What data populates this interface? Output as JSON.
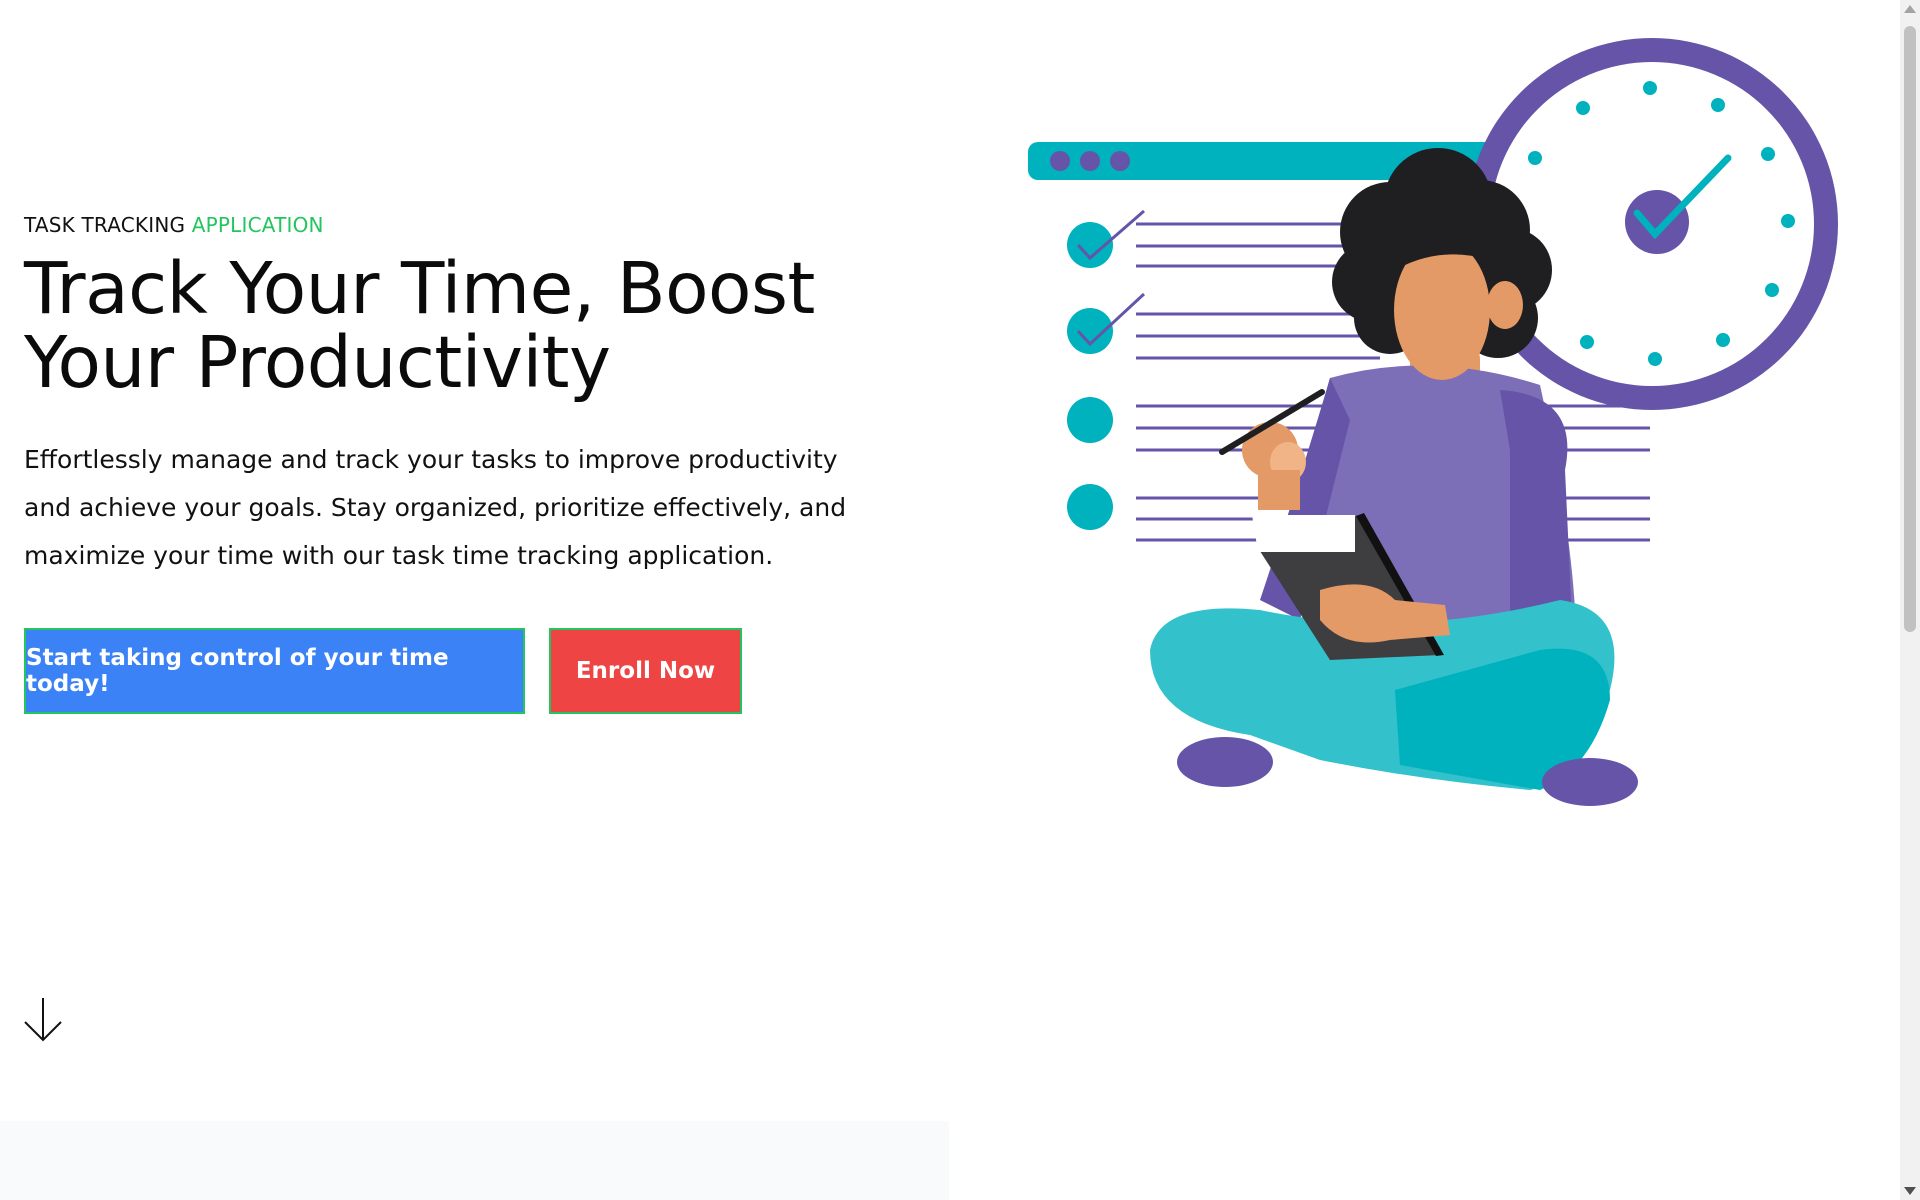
{
  "hero": {
    "eyebrow_main": "TASK TRACKING",
    "eyebrow_accent": "APPLICATION",
    "headline_line1": "Track Your Time, Boost",
    "headline_line2": "Your Productivity",
    "description_line1": "Effortlessly manage and track your tasks to improve productivity",
    "description_line2": "and achieve your goals. Stay organized, prioritize effectively, and",
    "description_line3": "maximize your time with our task time tracking application."
  },
  "actions": {
    "primary_label": "Start taking control of your time today!",
    "secondary_label": "Enroll Now"
  },
  "icons": {
    "scroll": "arrow-down-icon",
    "illustration": "woman-with-clock-checklist-illustration"
  },
  "colors": {
    "accent_green": "#22c55e",
    "primary_blue": "#3b82f6",
    "secondary_red": "#ef4444",
    "illustration_purple": "#6554a8",
    "illustration_teal": "#00b1be"
  }
}
